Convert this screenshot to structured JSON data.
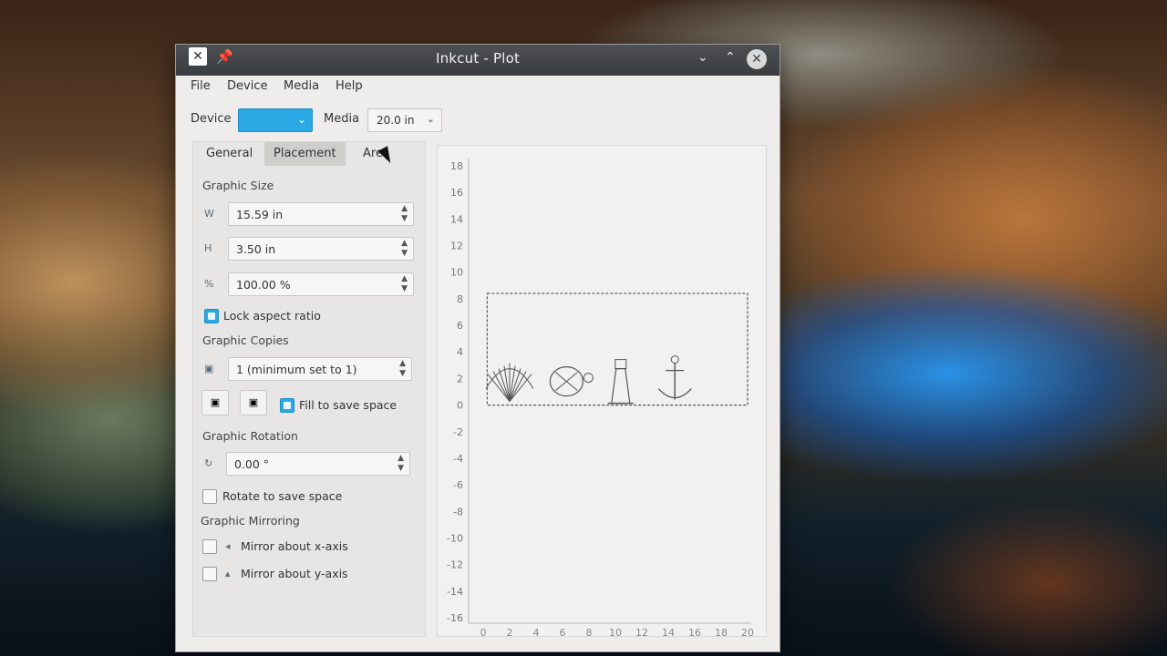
{
  "window": {
    "title": "Inkcut - Plot"
  },
  "menu": [
    "File",
    "Device",
    "Media",
    "Help"
  ],
  "toolbar": {
    "device_label": "Device",
    "device_value": "",
    "media_label": "Media",
    "media_value": "20.0 in"
  },
  "tabs": [
    "General",
    "Placement",
    "Are"
  ],
  "active_tab": "Placement",
  "graphic_size": {
    "label": "Graphic Size",
    "width": "15.59 in",
    "height": "3.50 in",
    "scale": "100.00 %",
    "lock_label": "Lock aspect ratio",
    "lock_checked": true
  },
  "graphic_copies": {
    "label": "Graphic Copies",
    "value": "1  (minimum set to 1)",
    "fill_label": "Fill to save space",
    "fill_checked": true
  },
  "graphic_rotation": {
    "label": "Graphic Rotation",
    "value": "0.00 °",
    "rotate_label": "Rotate to save space",
    "rotate_checked": false
  },
  "graphic_mirroring": {
    "label": "Graphic Mirroring",
    "x_label": "Mirror about x-axis",
    "y_label": "Mirror about y-axis",
    "x_checked": false,
    "y_checked": false
  },
  "icons": {
    "app": "inkcut-app-icon",
    "pin": "pin-icon",
    "minimize": "chevron-down-icon",
    "maximize": "chevron-up-icon",
    "close": "close-icon"
  },
  "colors": {
    "accent": "#2aa9e5",
    "titlebar": "#3f4245"
  },
  "chart_data": {
    "type": "scatter",
    "x_ticks": [
      0,
      2,
      4,
      6,
      8,
      10,
      12,
      14,
      16,
      18,
      20
    ],
    "y_ticks": [
      18,
      16,
      14,
      12,
      10,
      8,
      6,
      4,
      2,
      0,
      -2,
      -4,
      -6,
      -8,
      -10,
      -12,
      -14,
      -16
    ],
    "xlim": [
      0,
      20
    ],
    "ylim": [
      -16,
      18
    ],
    "bounding_box": {
      "x": [
        0.3,
        20
      ],
      "y": [
        0,
        8.4
      ]
    },
    "shapes": [
      "shell",
      "turtle",
      "lighthouse",
      "anchor"
    ]
  }
}
